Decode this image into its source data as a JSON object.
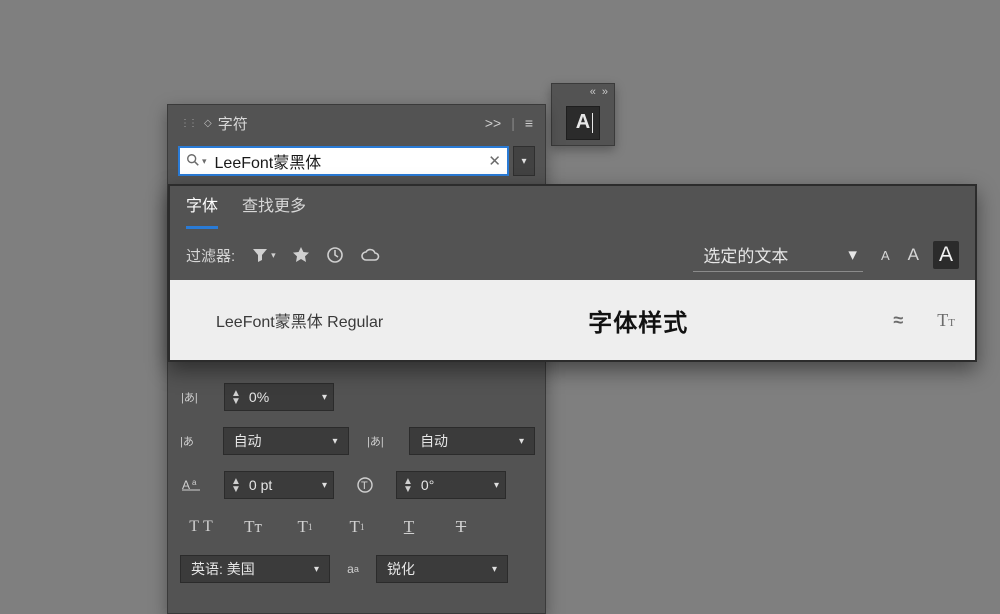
{
  "mini_palette": {
    "letter": "A"
  },
  "char_panel": {
    "title": "字符",
    "font_search_value": "LeeFont蒙黑体",
    "tracking_pct": "0%",
    "kerning_auto_left": "自动",
    "kerning_auto_right": "自动",
    "baseline_shift": "0 pt",
    "rotation": "0°",
    "language": "英语: 美国",
    "anti_alias": "锐化"
  },
  "font_dropdown": {
    "tab_fonts": "字体",
    "tab_findmore": "查找更多",
    "filter_label": "过滤器:",
    "selected_text": "选定的文本",
    "result_name": "LeeFont蒙黑体 Regular",
    "result_sample": "字体样式"
  }
}
